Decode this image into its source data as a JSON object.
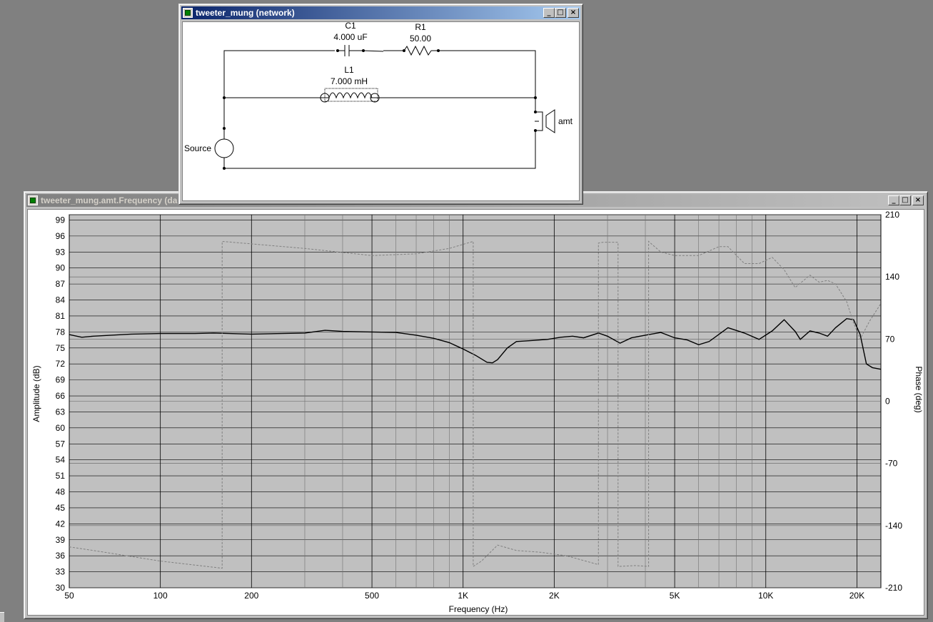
{
  "network_window": {
    "title": "tweeter_mung (network)",
    "buttons": {
      "minimize": "_",
      "maximize": "□",
      "close": "×"
    },
    "components": {
      "c1": {
        "name": "C1",
        "value": "4.000 uF"
      },
      "r1": {
        "name": "R1",
        "value": "50.00"
      },
      "l1": {
        "name": "L1",
        "value": "7.000 mH"
      },
      "source": {
        "name": "Source"
      },
      "driver": {
        "name": "amt"
      }
    }
  },
  "graph_window": {
    "title": "tweeter_mung.amt.Frequency (da",
    "buttons": {
      "minimize": "_",
      "maximize": "□",
      "close": "×"
    }
  },
  "chart_data": {
    "type": "line",
    "xlabel": "Frequency (Hz)",
    "ylabel": "Amplitude (dB)",
    "y2label": "Phase (deg)",
    "x_scale": "log",
    "xlim": [
      50,
      24000
    ],
    "ylim": [
      30,
      100
    ],
    "y2lim": [
      -210,
      210
    ],
    "grid": true,
    "x_ticks": [
      {
        "v": 50,
        "label": "50"
      },
      {
        "v": 100,
        "label": "100"
      },
      {
        "v": 200,
        "label": "200"
      },
      {
        "v": 500,
        "label": "500"
      },
      {
        "v": 1000,
        "label": "1K"
      },
      {
        "v": 2000,
        "label": "2K"
      },
      {
        "v": 5000,
        "label": "5K"
      },
      {
        "v": 10000,
        "label": "10K"
      },
      {
        "v": 20000,
        "label": "20K"
      }
    ],
    "x_minor": [
      300,
      400,
      600,
      700,
      800,
      900,
      3000,
      4000,
      6000,
      7000,
      8000,
      9000
    ],
    "y_ticks": [
      99,
      96,
      93,
      90,
      87,
      84,
      81,
      78,
      75,
      72,
      69,
      66,
      63,
      60,
      57,
      54,
      51,
      48,
      45,
      42,
      39,
      36,
      33,
      30
    ],
    "y2_ticks": [
      210,
      140,
      70,
      0,
      -70,
      -140,
      -210
    ],
    "series": [
      {
        "role": "amplitude",
        "color": "#000000",
        "style": "solid",
        "points": [
          [
            50,
            77.5
          ],
          [
            55,
            77.0
          ],
          [
            60,
            77.2
          ],
          [
            80,
            77.6
          ],
          [
            100,
            77.7
          ],
          [
            130,
            77.7
          ],
          [
            150,
            77.8
          ],
          [
            200,
            77.6
          ],
          [
            300,
            77.8
          ],
          [
            350,
            78.3
          ],
          [
            400,
            78.1
          ],
          [
            500,
            78.0
          ],
          [
            600,
            77.9
          ],
          [
            700,
            77.4
          ],
          [
            800,
            76.8
          ],
          [
            900,
            76.0
          ],
          [
            1000,
            74.8
          ],
          [
            1100,
            73.6
          ],
          [
            1200,
            72.3
          ],
          [
            1250,
            72.2
          ],
          [
            1300,
            72.8
          ],
          [
            1400,
            75.0
          ],
          [
            1500,
            76.2
          ],
          [
            1700,
            76.4
          ],
          [
            1900,
            76.6
          ],
          [
            2100,
            77.0
          ],
          [
            2300,
            77.2
          ],
          [
            2500,
            76.9
          ],
          [
            2800,
            77.8
          ],
          [
            3000,
            77.2
          ],
          [
            3300,
            75.9
          ],
          [
            3600,
            76.9
          ],
          [
            4000,
            77.4
          ],
          [
            4500,
            77.9
          ],
          [
            5000,
            76.9
          ],
          [
            5500,
            76.5
          ],
          [
            6000,
            75.6
          ],
          [
            6500,
            76.2
          ],
          [
            7500,
            78.8
          ],
          [
            8500,
            77.8
          ],
          [
            9500,
            76.6
          ],
          [
            10500,
            78.2
          ],
          [
            11500,
            80.3
          ],
          [
            12500,
            78.1
          ],
          [
            13000,
            76.6
          ],
          [
            14000,
            78.2
          ],
          [
            15000,
            77.8
          ],
          [
            16000,
            77.2
          ],
          [
            17000,
            78.8
          ],
          [
            18500,
            80.5
          ],
          [
            19500,
            80.3
          ],
          [
            20500,
            77.5
          ],
          [
            21500,
            72.0
          ],
          [
            22500,
            71.3
          ],
          [
            24000,
            71.0
          ]
        ]
      },
      {
        "role": "phase",
        "color": "#808080",
        "style": "dashed",
        "points": [
          [
            50,
            -164
          ],
          [
            60,
            -168
          ],
          [
            100,
            -180
          ],
          [
            160,
            -188
          ],
          [
            160,
            180
          ],
          [
            300,
            172
          ],
          [
            500,
            164
          ],
          [
            700,
            166
          ],
          [
            900,
            172
          ],
          [
            1080,
            180
          ],
          [
            1080,
            -186
          ],
          [
            1150,
            -180
          ],
          [
            1300,
            -162
          ],
          [
            1500,
            -168
          ],
          [
            1800,
            -170
          ],
          [
            2200,
            -174
          ],
          [
            2800,
            -184
          ],
          [
            2800,
            178
          ],
          [
            2900,
            179
          ],
          [
            3250,
            179
          ],
          [
            3250,
            -186
          ],
          [
            3700,
            -185
          ],
          [
            4100,
            -186
          ],
          [
            4100,
            180
          ],
          [
            4500,
            168
          ],
          [
            5000,
            164
          ],
          [
            6000,
            164
          ],
          [
            7000,
            174
          ],
          [
            7500,
            174
          ],
          [
            8500,
            155
          ],
          [
            9500,
            155
          ],
          [
            10500,
            162
          ],
          [
            11500,
            148
          ],
          [
            12500,
            128
          ],
          [
            14000,
            142
          ],
          [
            15000,
            134
          ],
          [
            16000,
            136
          ],
          [
            17000,
            132
          ],
          [
            18500,
            112
          ],
          [
            19500,
            88
          ],
          [
            20500,
            70
          ],
          [
            22000,
            90
          ],
          [
            24000,
            110
          ]
        ]
      }
    ]
  }
}
